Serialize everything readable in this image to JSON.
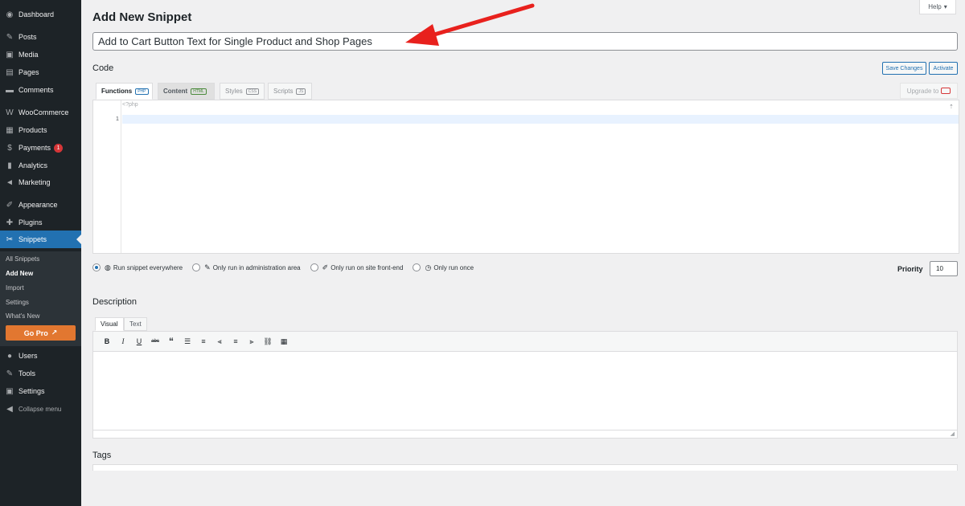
{
  "sidebar": {
    "items": [
      {
        "label": "Dashboard",
        "icon": "dashboard-icon",
        "glyph": "◉"
      },
      {
        "label": "Posts",
        "icon": "pin-icon",
        "glyph": "✎"
      },
      {
        "label": "Media",
        "icon": "media-icon",
        "glyph": "▣"
      },
      {
        "label": "Pages",
        "icon": "pages-icon",
        "glyph": "▤"
      },
      {
        "label": "Comments",
        "icon": "comments-icon",
        "glyph": "▬"
      },
      {
        "label": "WooCommerce",
        "icon": "woo-icon",
        "glyph": "W"
      },
      {
        "label": "Products",
        "icon": "products-icon",
        "glyph": "▦"
      },
      {
        "label": "Payments",
        "icon": "payments-icon",
        "glyph": "$",
        "badge": "1"
      },
      {
        "label": "Analytics",
        "icon": "analytics-icon",
        "glyph": "▮"
      },
      {
        "label": "Marketing",
        "icon": "megaphone-icon",
        "glyph": "◄"
      },
      {
        "label": "Appearance",
        "icon": "brush-icon",
        "glyph": "✐"
      },
      {
        "label": "Plugins",
        "icon": "plugin-icon",
        "glyph": "✚"
      },
      {
        "label": "Snippets",
        "icon": "scissors-icon",
        "glyph": "✂"
      }
    ],
    "submenu": [
      "All Snippets",
      "Add New",
      "Import",
      "Settings",
      "What's New"
    ],
    "go_pro": "Go Pro",
    "bottom_items": [
      {
        "label": "Users",
        "icon": "users-icon",
        "glyph": "●"
      },
      {
        "label": "Tools",
        "icon": "wrench-icon",
        "glyph": "✎"
      },
      {
        "label": "Settings",
        "icon": "settings-icon",
        "glyph": "▣"
      },
      {
        "label": "Collapse menu",
        "icon": "collapse-icon",
        "glyph": "◀"
      }
    ]
  },
  "header": {
    "title": "Add New Snippet",
    "help": "Help"
  },
  "snippet": {
    "title_value": "Add to Cart Button Text for Single Product and Shop Pages"
  },
  "code": {
    "label": "Code",
    "save_label": "Save Changes",
    "activate_label": "Activate",
    "tabs": [
      {
        "label": "Functions",
        "tag": "PHP"
      },
      {
        "label": "Content",
        "tag": "HTML"
      },
      {
        "label": "Styles",
        "tag": "CSS"
      },
      {
        "label": "Scripts",
        "tag": "JS"
      }
    ],
    "upgrade_label": "Upgrade to",
    "php_open": "<?php",
    "line_number": "1"
  },
  "scope": {
    "options": [
      {
        "label": "Run snippet everywhere",
        "icon": "globe-icon",
        "glyph": "◍",
        "checked": true
      },
      {
        "label": "Only run in administration area",
        "icon": "wrench-icon",
        "glyph": "✎",
        "checked": false
      },
      {
        "label": "Only run on site front-end",
        "icon": "brush-icon",
        "glyph": "✐",
        "checked": false
      },
      {
        "label": "Only run once",
        "icon": "clock-icon",
        "glyph": "◷",
        "checked": false
      }
    ],
    "priority_label": "Priority",
    "priority_value": "10"
  },
  "description": {
    "label": "Description",
    "tabs": [
      "Visual",
      "Text"
    ]
  },
  "tags": {
    "label": "Tags"
  },
  "colors": {
    "sidebar_bg": "#1d2327",
    "accent": "#2271b1",
    "go_pro": "#e27730",
    "arrow": "#e8211d"
  }
}
